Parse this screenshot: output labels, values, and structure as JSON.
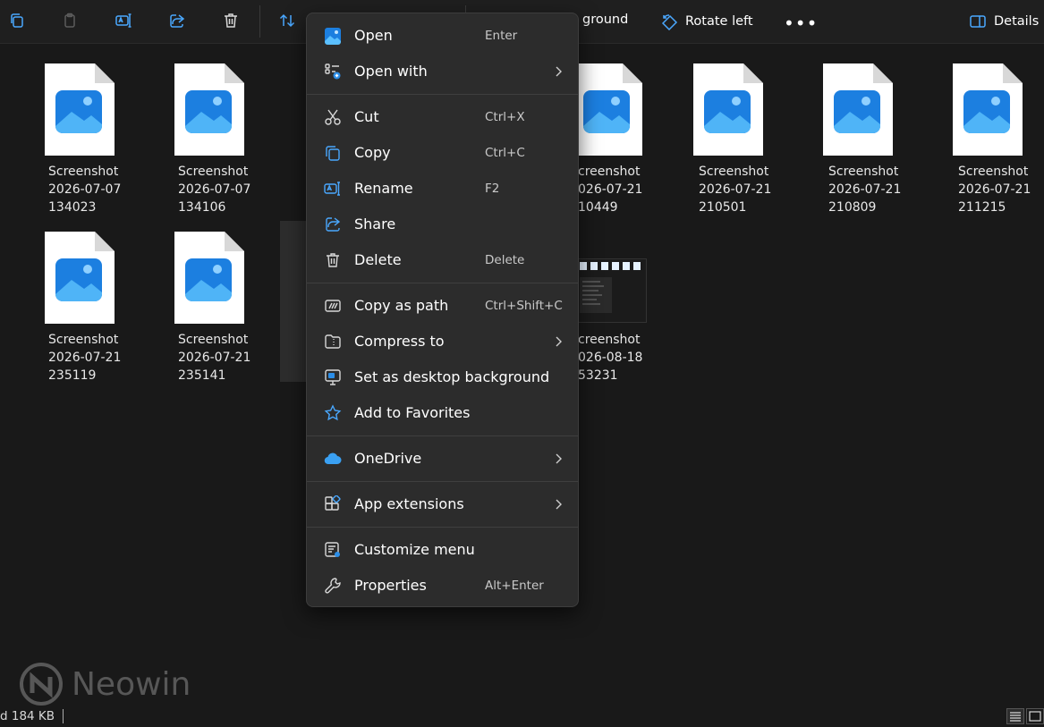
{
  "toolbar": {
    "icons": [
      "copy-icon",
      "paste-icon",
      "rename-icon",
      "share-icon",
      "delete-icon",
      "sort-icon"
    ],
    "background_partial": "ground",
    "rotate_left": "Rotate left",
    "more": "•••",
    "details": "Details"
  },
  "files": [
    {
      "name": "Screenshot",
      "date": "2026-07-07",
      "time": "134023",
      "partial": false
    },
    {
      "name": "Screenshot",
      "date": "2026-07-07",
      "time": "134106",
      "partial": false
    },
    {
      "name": "creenshot",
      "date": "026-07-21",
      "time": "10449",
      "partial": true
    },
    {
      "name": "Screenshot",
      "date": "2026-07-21",
      "time": "210501",
      "partial": false
    },
    {
      "name": "Screenshot",
      "date": "2026-07-21",
      "time": "210809",
      "partial": false
    },
    {
      "name": "Screenshot",
      "date": "2026-07-21",
      "time": "211215",
      "partial": false
    },
    {
      "name": "Screenshot",
      "date": "2026-07-21",
      "time": "235119",
      "partial": false
    },
    {
      "name": "Screenshot",
      "date": "2026-07-21",
      "time": "235141",
      "partial": false
    },
    {
      "name": "creenshot",
      "date": "026-08-18",
      "time": "53231",
      "partial": true
    }
  ],
  "context_menu": {
    "items": [
      {
        "label": "Open",
        "shortcut": "Enter",
        "icon": "photos-icon",
        "submenu": false
      },
      {
        "label": "Open with",
        "shortcut": "",
        "icon": "open-with-icon",
        "submenu": true
      },
      {
        "label": "Cut",
        "shortcut": "Ctrl+X",
        "icon": "scissors-icon",
        "submenu": false
      },
      {
        "label": "Copy",
        "shortcut": "Ctrl+C",
        "icon": "copy-icon",
        "submenu": false
      },
      {
        "label": "Rename",
        "shortcut": "F2",
        "icon": "rename-icon",
        "submenu": false
      },
      {
        "label": "Share",
        "shortcut": "",
        "icon": "share-icon",
        "submenu": false
      },
      {
        "label": "Delete",
        "shortcut": "Delete",
        "icon": "trash-icon",
        "submenu": false
      },
      {
        "label": "Copy as path",
        "shortcut": "Ctrl+Shift+C",
        "icon": "copy-path-icon",
        "submenu": false
      },
      {
        "label": "Compress to",
        "shortcut": "",
        "icon": "zip-folder-icon",
        "submenu": true
      },
      {
        "label": "Set as desktop background",
        "shortcut": "",
        "icon": "desktop-background-icon",
        "submenu": false
      },
      {
        "label": "Add to Favorites",
        "shortcut": "",
        "icon": "star-icon",
        "submenu": false
      },
      {
        "label": "OneDrive",
        "shortcut": "",
        "icon": "onedrive-cloud-icon",
        "submenu": true
      },
      {
        "label": "App extensions",
        "shortcut": "",
        "icon": "app-extensions-icon",
        "submenu": true
      },
      {
        "label": "Customize menu",
        "shortcut": "",
        "icon": "customize-menu-icon",
        "submenu": false
      },
      {
        "label": "Properties",
        "shortcut": "Alt+Enter",
        "icon": "wrench-icon",
        "submenu": false
      }
    ]
  },
  "watermark": {
    "text": "Neowin"
  },
  "statusbar": {
    "text": "d  184 KB"
  },
  "colors": {
    "background": "#191919",
    "menu_background": "#2c2c2c",
    "accent": "#2b8ee8",
    "onedrive": "#3aa0f2"
  }
}
